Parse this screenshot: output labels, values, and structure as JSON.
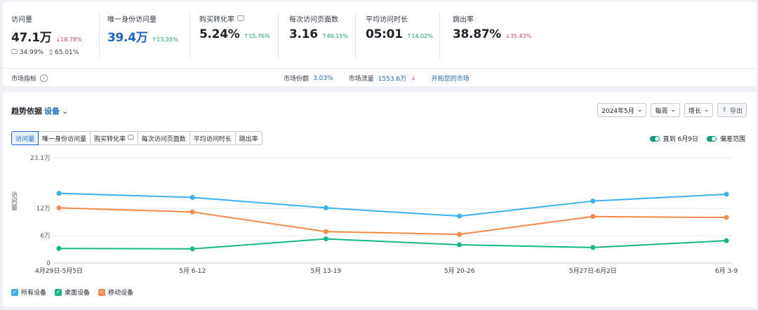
{
  "metrics": [
    {
      "label": "访问量",
      "value": "47.1万",
      "change": "18.78%",
      "dir": "down",
      "sub": [
        {
          "icon": "desktop-icon",
          "text": "34.99%"
        },
        {
          "icon": "mobile-icon",
          "text": "65.01%"
        }
      ]
    },
    {
      "label": "唯一身份访问量",
      "value": "39.4万",
      "change": "13.35%",
      "dir": "up"
    },
    {
      "label": "购买转化率",
      "value": "5.24%",
      "change": "15.76%",
      "dir": "up",
      "icon": "desktop-icon"
    },
    {
      "label": "每次访问页面数",
      "value": "3.16",
      "change": "46.15%",
      "dir": "up"
    },
    {
      "label": "平均访问时长",
      "value": "05:01",
      "change": "14.02%",
      "dir": "up"
    },
    {
      "label": "跳出率",
      "value": "38.87%",
      "change": "35.43%",
      "dir": "down"
    }
  ],
  "market": {
    "indicator_label": "市场指标",
    "share_label": "市场份额",
    "share_value": "3.03%",
    "traffic_label": "市场流量",
    "traffic_value": "1553.6万",
    "explore_link": "开拓您的市场"
  },
  "trend": {
    "title": "趋势依据",
    "selector": "设备",
    "controls": {
      "month": "2024年5月",
      "period": "每周",
      "mode": "增长",
      "export": "导出"
    },
    "tabs": [
      "访问量",
      "唯一身份访问量",
      "购买转化率",
      "每次访问页面数",
      "平均访问时长",
      "跳出率"
    ],
    "toggles": [
      "直到 6月9日",
      "偏差范围"
    ]
  },
  "chart_data": {
    "type": "line",
    "x": [
      "4月29日-5月5日",
      "5月 6-12",
      "5月 13-19",
      "5月 20-26",
      "5月27日-6月2日",
      "6月 3-9"
    ],
    "ylabel": "访问量",
    "yticks": [
      {
        "v": 0,
        "label": "0"
      },
      {
        "v": 6,
        "label": "6万"
      },
      {
        "v": 12,
        "label": "12万"
      },
      {
        "v": 23.1,
        "label": "23.1万"
      }
    ],
    "ylim": [
      0,
      23.1
    ],
    "grid": true,
    "series": [
      {
        "name": "所有设备",
        "color": "#3ab0f0",
        "values": [
          15.3,
          14.4,
          12.1,
          10.3,
          13.6,
          15.1
        ]
      },
      {
        "name": "桌面设备",
        "color": "#12b886",
        "values": [
          3.2,
          3.1,
          5.3,
          4.0,
          3.4,
          4.9
        ]
      },
      {
        "name": "移动设备",
        "color": "#f5884a",
        "values": [
          12.1,
          11.2,
          6.9,
          6.3,
          10.2,
          10.0
        ]
      }
    ]
  }
}
